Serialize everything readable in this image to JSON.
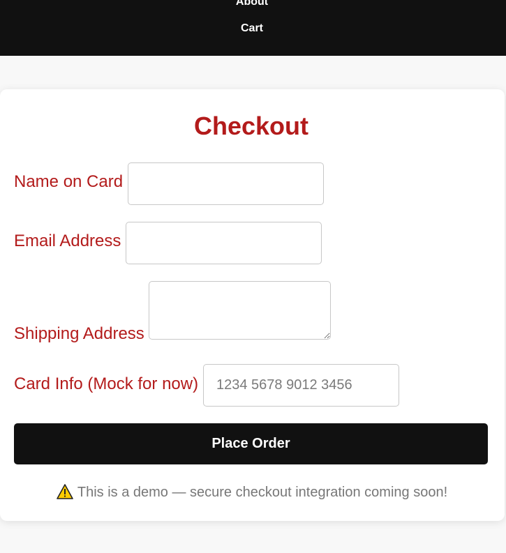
{
  "nav": {
    "links": [
      {
        "label": "About"
      },
      {
        "label": "Cart"
      }
    ],
    "background": "#111111"
  },
  "checkout": {
    "title": "Checkout",
    "accent_color": "#b31b1b",
    "fields": {
      "name": {
        "label": "Name on Card",
        "value": "",
        "placeholder": ""
      },
      "email": {
        "label": "Email Address",
        "value": "",
        "placeholder": ""
      },
      "address": {
        "label": "Shipping Address",
        "value": "",
        "placeholder": ""
      },
      "card": {
        "label": "Card Info (Mock for now)",
        "value": "",
        "placeholder": "1234 5678 9012 3456"
      }
    },
    "submit_label": "Place Order",
    "notice": {
      "icon": "warning-icon",
      "text": "This is a demo — secure checkout integration coming soon!"
    }
  }
}
